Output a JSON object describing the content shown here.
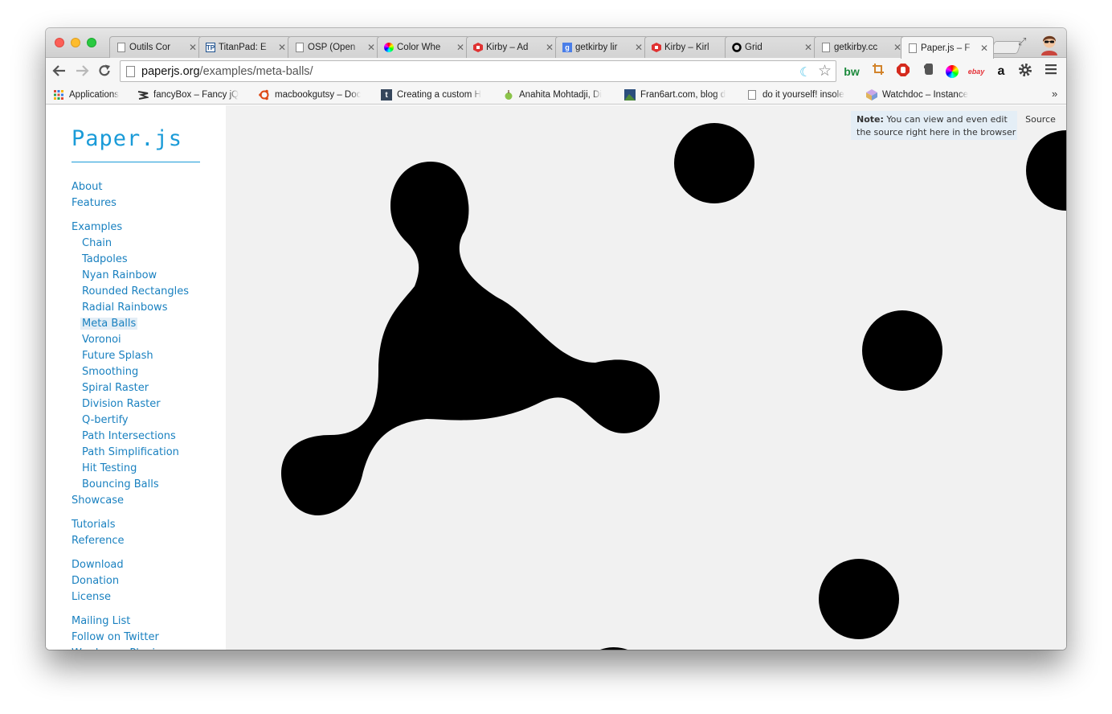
{
  "browser": {
    "tabs": [
      {
        "title": "Outils Cor",
        "favicon": "page-icon"
      },
      {
        "title": "TitanPad: E",
        "favicon": "titanpad-icon"
      },
      {
        "title": "OSP (Open",
        "favicon": "page-icon"
      },
      {
        "title": "Color Whe",
        "favicon": "color-wheel-icon"
      },
      {
        "title": "Kirby – Ad",
        "favicon": "kirby-icon"
      },
      {
        "title": "getkirby lir",
        "favicon": "google-icon"
      },
      {
        "title": "Kirby – Kirl",
        "favicon": "kirby-icon"
      },
      {
        "title": "Grid",
        "favicon": "grid-circle-icon"
      },
      {
        "title": "getkirby.cc",
        "favicon": "page-icon"
      },
      {
        "title": "Paper.js – F",
        "favicon": "page-icon",
        "active": true
      }
    ],
    "url_host": "paperjs.org",
    "url_path": "/examples/meta-balls/",
    "extensions": [
      "moon-icon",
      "star-icon",
      "bw-icon",
      "crop-icon",
      "stop-icon",
      "evernote-icon",
      "color-picker-icon",
      "ebay-icon",
      "amazon-icon",
      "settings-icon",
      "menu-icon"
    ],
    "ext_labels": {
      "bw": "bw",
      "ebay": "ebay",
      "amazon": "a"
    },
    "bookmarks": [
      {
        "label": "Applications",
        "icon": "apps-grid-icon"
      },
      {
        "label": "fancyBox – Fancy jQ",
        "icon": "fancybox-icon"
      },
      {
        "label": "macbookgutsy – Doc",
        "icon": "ubuntu-icon"
      },
      {
        "label": "Creating a custom H",
        "icon": "tumblr-icon"
      },
      {
        "label": "Anahita Mohtadji, Di",
        "icon": "apple-icon"
      },
      {
        "label": "Fran6art.com, blog d",
        "icon": "image-icon"
      },
      {
        "label": "do it yourself! insole",
        "icon": "page-icon"
      },
      {
        "label": "Watchdoc – Instance",
        "icon": "watchdoc-icon"
      }
    ],
    "bookmarks_more": "»"
  },
  "sidebar": {
    "logo": "Paper.js",
    "nav": [
      {
        "label": "About"
      },
      {
        "label": "Features"
      },
      {
        "label": "Examples"
      },
      {
        "label": "Chain",
        "sub": true
      },
      {
        "label": "Tadpoles",
        "sub": true
      },
      {
        "label": "Nyan Rainbow",
        "sub": true
      },
      {
        "label": "Rounded Rectangles",
        "sub": true
      },
      {
        "label": "Radial Rainbows",
        "sub": true
      },
      {
        "label": "Meta Balls",
        "sub": true,
        "active": true
      },
      {
        "label": "Voronoi",
        "sub": true
      },
      {
        "label": "Future Splash",
        "sub": true
      },
      {
        "label": "Smoothing",
        "sub": true
      },
      {
        "label": "Spiral Raster",
        "sub": true
      },
      {
        "label": "Division Raster",
        "sub": true
      },
      {
        "label": "Q-bertify",
        "sub": true
      },
      {
        "label": "Path Intersections",
        "sub": true
      },
      {
        "label": "Path Simplification",
        "sub": true
      },
      {
        "label": "Hit Testing",
        "sub": true
      },
      {
        "label": "Bouncing Balls",
        "sub": true
      },
      {
        "label": "Showcase"
      },
      {
        "label": "Tutorials"
      },
      {
        "label": "Reference"
      },
      {
        "label": "Download"
      },
      {
        "label": "Donation"
      },
      {
        "label": "License"
      },
      {
        "label": "Mailing List"
      },
      {
        "label": "Follow on Twitter"
      },
      {
        "label": "Wordpress Plugin"
      }
    ]
  },
  "canvas": {
    "note_label": "Note:",
    "note_text": "You can view and even edit the source right here in the browser",
    "source_label": "Source",
    "ball_color": "#000000",
    "background_color": "#f1f1f1"
  }
}
